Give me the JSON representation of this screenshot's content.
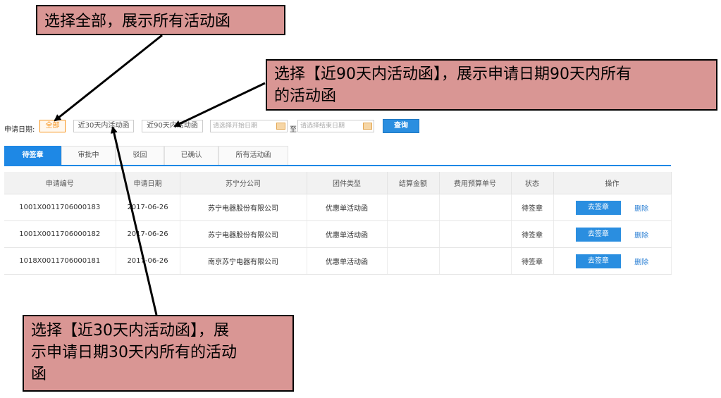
{
  "callouts": {
    "top": "选择全部，展示所有活动函",
    "right_line1": "选择【近90天内活动函】，展示申请日期90天内所有",
    "right_line2": "的活动函",
    "bottom_line1": "选择【近30天内活动函】，展",
    "bottom_line2": "示申请日期30天内所有的活动",
    "bottom_line3": "函"
  },
  "filters": {
    "label": "申请日期:",
    "all": "全部",
    "last30": "近30天内活动函",
    "last90": "近90天内活动函",
    "start_placeholder": "请选择开始日期",
    "to": "至",
    "end_placeholder": "请选择结束日期",
    "query": "查询"
  },
  "tabs": [
    "待签章",
    "审批中",
    "驳回",
    "已确认",
    "所有活动函"
  ],
  "table": {
    "headers": [
      "申请编号",
      "申请日期",
      "苏宁分公司",
      "团件类型",
      "结算金额",
      "费用预算单号",
      "状态",
      "操作"
    ],
    "rows": [
      {
        "id": "1001X0011706000183",
        "date": "2017-06-26",
        "company": "苏宁电器股份有限公司",
        "type": "优惠单活动函",
        "amount": "",
        "budget": "",
        "status": "待签章",
        "action": "去签章",
        "delete": "删除"
      },
      {
        "id": "1001X0011706000182",
        "date": "2017-06-26",
        "company": "苏宁电器股份有限公司",
        "type": "优惠单活动函",
        "amount": "",
        "budget": "",
        "status": "待签章",
        "action": "去签章",
        "delete": "删除"
      },
      {
        "id": "1018X0011706000181",
        "date": "2017-06-26",
        "company": "南京苏宁电器有限公司",
        "type": "优惠单活动函",
        "amount": "",
        "budget": "",
        "status": "待签章",
        "action": "去签章",
        "delete": "删除"
      }
    ]
  },
  "colors": {
    "accent": "#1e88e5",
    "callout_bg": "#d99694",
    "all_button": "#f7941d"
  }
}
